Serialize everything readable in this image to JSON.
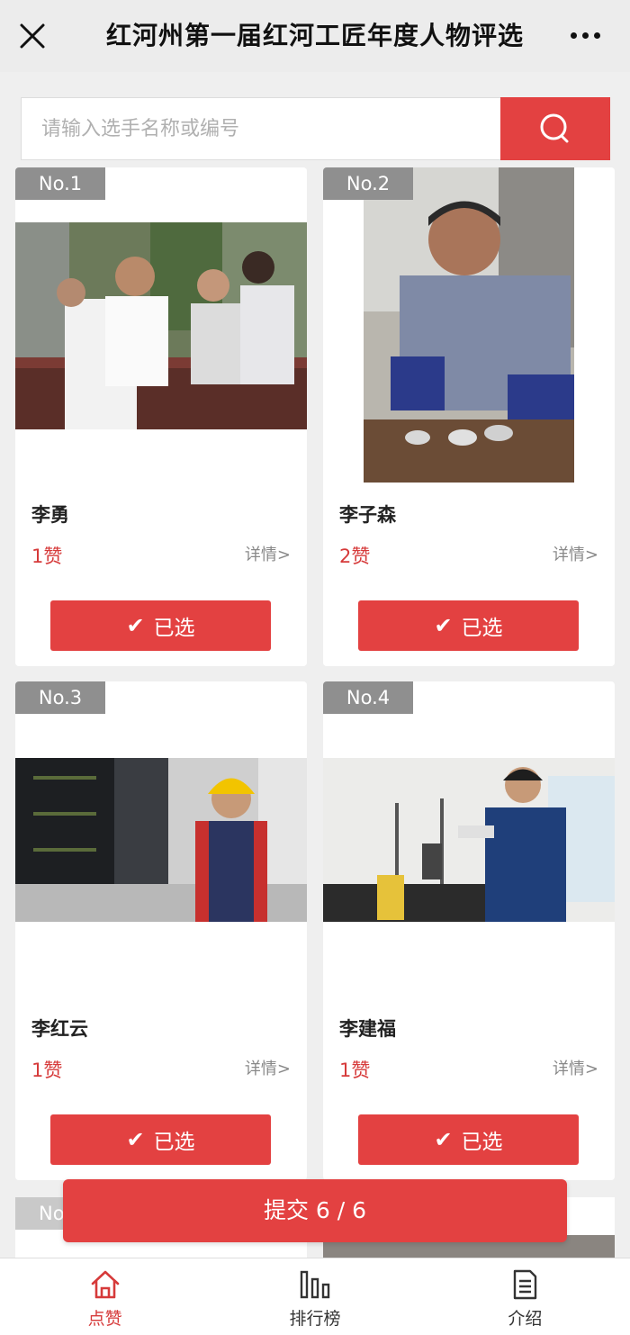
{
  "header": {
    "title": "红河州第一届红河工匠年度人物评选",
    "close_icon": "close-icon",
    "more_icon": "more-icon"
  },
  "search": {
    "placeholder": "请输入选手名称或编号",
    "button_icon": "search-icon"
  },
  "candidates": [
    {
      "no": "No.1",
      "name": "李勇",
      "likes": "1赞",
      "detail": "详情>",
      "button": "已选",
      "check": "✔"
    },
    {
      "no": "No.2",
      "name": "李子森",
      "likes": "2赞",
      "detail": "详情>",
      "button": "已选",
      "check": "✔"
    },
    {
      "no": "No.3",
      "name": "李红云",
      "likes": "1赞",
      "detail": "详情>",
      "button": "已选",
      "check": "✔"
    },
    {
      "no": "No.4",
      "name": "李建福",
      "likes": "1赞",
      "detail": "详情>",
      "button": "已选",
      "check": "✔"
    }
  ],
  "partial_card": {
    "no": "No"
  },
  "submit": {
    "label": "提交 6 / 6"
  },
  "tabs": [
    {
      "label": "点赞",
      "icon": "home-icon",
      "active": true
    },
    {
      "label": "排行榜",
      "icon": "bar-chart-icon",
      "active": false
    },
    {
      "label": "介绍",
      "icon": "document-icon",
      "active": false
    }
  ],
  "colors": {
    "accent": "#e34141",
    "badge": "#8f8f8f",
    "likes": "#d63a3a"
  }
}
